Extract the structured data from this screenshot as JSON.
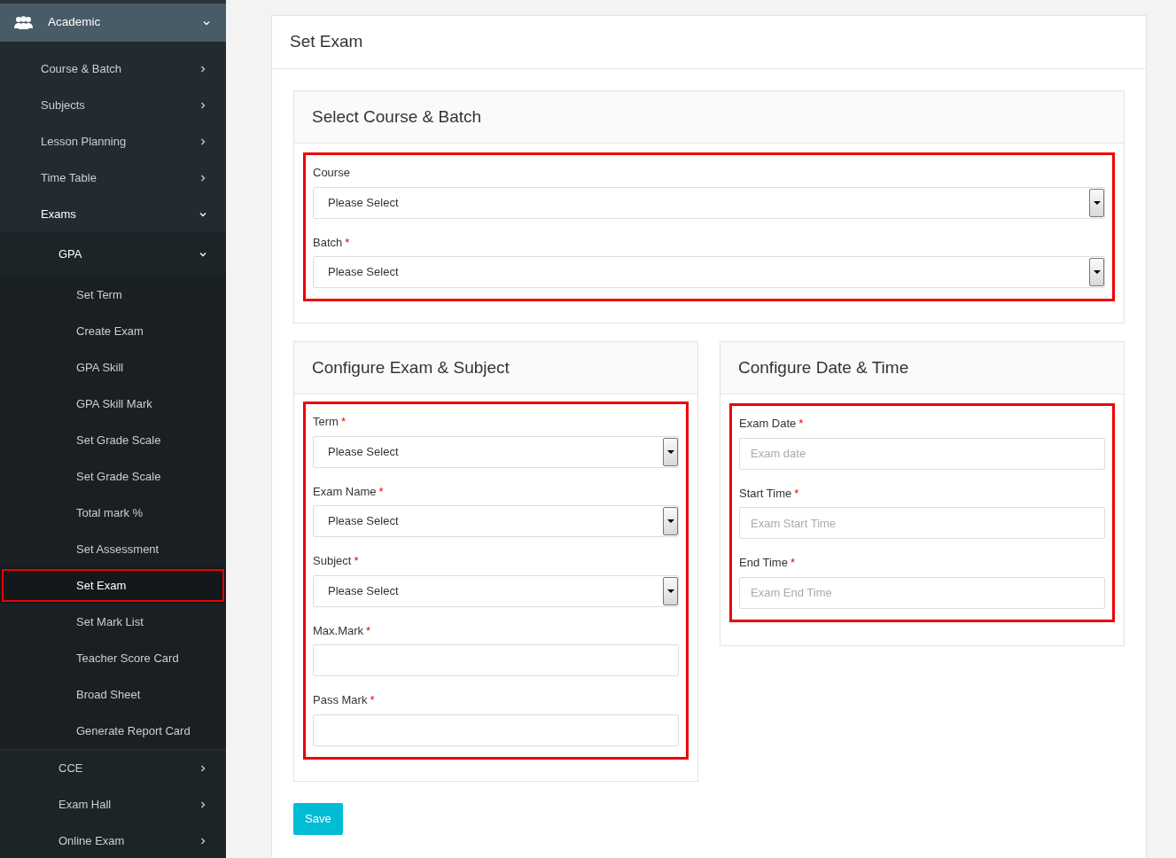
{
  "sidebar": {
    "header": {
      "label": "Academic",
      "expanded": true
    },
    "items": [
      {
        "label": "Course & Batch",
        "expanded": false,
        "selected": false
      },
      {
        "label": "Subjects",
        "expanded": false,
        "selected": false
      },
      {
        "label": "Lesson Planning",
        "expanded": false,
        "selected": false
      },
      {
        "label": "Time Table",
        "expanded": false,
        "selected": false
      },
      {
        "label": "Exams",
        "expanded": true,
        "selected": false,
        "children": [
          {
            "label": "GPA",
            "expanded": true,
            "selected": false,
            "children": [
              {
                "label": "Set Term",
                "selected": false,
                "highlighted": false
              },
              {
                "label": "Create Exam",
                "selected": false,
                "highlighted": false
              },
              {
                "label": "GPA Skill",
                "selected": false,
                "highlighted": false
              },
              {
                "label": "GPA Skill Mark",
                "selected": false,
                "highlighted": false
              },
              {
                "label": "Set Grade Scale",
                "selected": false,
                "highlighted": false
              },
              {
                "label": "Set Grade Scale",
                "selected": false,
                "highlighted": false
              },
              {
                "label": "Total mark %",
                "selected": false,
                "highlighted": false
              },
              {
                "label": "Set Assessment",
                "selected": false,
                "highlighted": false
              },
              {
                "label": "Set Exam",
                "selected": true,
                "highlighted": true
              },
              {
                "label": "Set Mark List",
                "selected": false,
                "highlighted": false
              },
              {
                "label": "Teacher Score Card",
                "selected": false,
                "highlighted": false
              },
              {
                "label": "Broad Sheet",
                "selected": false,
                "highlighted": false
              },
              {
                "label": "Generate Report Card",
                "selected": false,
                "highlighted": false
              }
            ]
          },
          {
            "label": "CCE",
            "expanded": false,
            "selected": false
          },
          {
            "label": "Exam Hall",
            "expanded": false,
            "selected": false
          },
          {
            "label": "Online Exam",
            "expanded": false,
            "selected": false
          }
        ]
      }
    ]
  },
  "page": {
    "title": "Set Exam",
    "course_panel": {
      "title": "Select Course & Batch",
      "highlighted": true,
      "fields": [
        {
          "label": "Course",
          "kind": "select",
          "value": "Please Select"
        },
        {
          "label": "Batch",
          "asterisk": "*",
          "kind": "select",
          "value": "Please Select"
        }
      ]
    },
    "exam_panel": {
      "title": "Configure Exam & Subject",
      "highlighted": true,
      "fields": [
        {
          "label": "Term",
          "asterisk": "*",
          "kind": "select",
          "value": "Please Select"
        },
        {
          "label": "Exam Name",
          "asterisk": "*",
          "kind": "select",
          "value": "Please Select"
        },
        {
          "label": "Subject",
          "asterisk": "*",
          "kind": "select",
          "value": "Please Select"
        },
        {
          "label": "Max.Mark",
          "asterisk": "*",
          "kind": "input"
        },
        {
          "label": "Pass Mark",
          "asterisk": "*",
          "kind": "input"
        }
      ]
    },
    "date_panel": {
      "title": "Configure Date & Time",
      "highlighted": true,
      "fields": [
        {
          "label": "Exam Date",
          "asterisk": "*",
          "kind": "input",
          "placeholder": "Exam date"
        },
        {
          "label": "Start Time",
          "asterisk": "*",
          "kind": "input",
          "placeholder": "Exam Start Time"
        },
        {
          "label": "End Time",
          "asterisk": "*",
          "kind": "input",
          "placeholder": "Exam End Time"
        }
      ]
    },
    "save_button": "Save"
  }
}
